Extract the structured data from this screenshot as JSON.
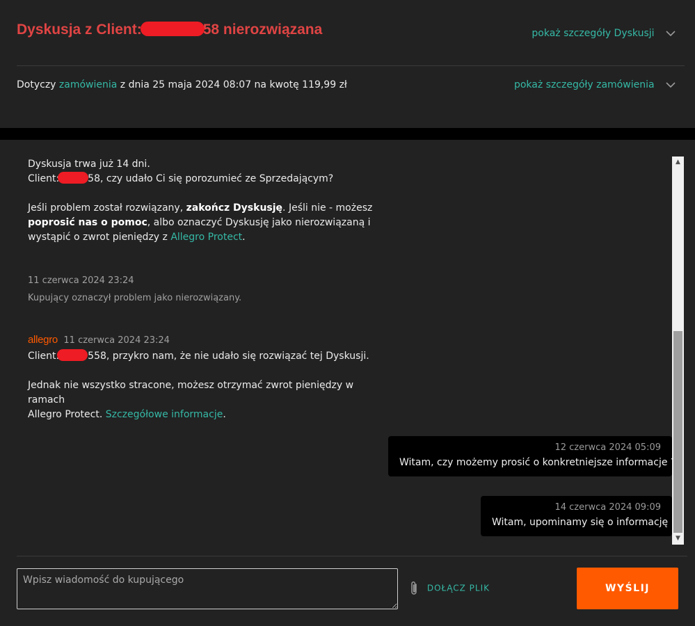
{
  "header": {
    "title_prefix": "Dyskusja z Client:",
    "title_suffix": "58 nierozwiązana",
    "show_discussion_details": "pokaż szczegóły Dyskusji",
    "order_text_1": "Dotyczy",
    "order_link": "zamówienia",
    "order_text_2": "z dnia 25 maja 2024 08:07 na kwotę 119,99 zł",
    "show_order_details": "pokaż szczegóły zamówienia"
  },
  "thread": {
    "status_line1": "Dyskusja trwa już 14 dni.",
    "status_client": "Client:",
    "status_q": "558, czy udało Ci się porozumieć ze Sprzedającym?",
    "info_1": "Jeśli problem został rozwiązany,",
    "info_bold_1": "zakończ Dyskusję",
    "info_2": ". Jeśli nie - możesz",
    "info_bold_2": "poprosić nas o pomoc",
    "info_3": ", albo oznaczyć Dyskusję jako nierozwiązaną i",
    "info_4": "wystąpić o zwrot pieniędzy z",
    "info_link": "Allegro Protect",
    "info_end": ".",
    "event_time": "11 czerwca 2024 23:24",
    "event_text": "Kupujący oznaczył problem jako nierozwiązany.",
    "allegro_logo": "allegro",
    "allegro_time": "11 czerwca 2024 23:24",
    "allegro_client": "Client:",
    "allegro_msg_1": "9558, przykro nam, że nie udało się rozwiązać tej Dyskusji.",
    "allegro_msg_2": "Jednak nie wszystko stracone, możesz otrzymać zwrot pieniędzy w ramach",
    "allegro_msg_3": "Allegro Protect.",
    "allegro_link": "Szczegółowe informacje",
    "allegro_end": ".",
    "messages": [
      {
        "time": "12 czerwca 2024 05:09",
        "text": "Witam, czy możemy prosić o konkretniejsze informacje ?"
      },
      {
        "time": "14 czerwca 2024 09:09",
        "text": "Witam, upominamy się o informację"
      }
    ]
  },
  "composer": {
    "placeholder": "Wpisz wiadomość do kupującego",
    "attach_label": "DOŁĄCZ PLIK",
    "send_label": "WYŚLIJ"
  },
  "colors": {
    "accent": "#35b9a6",
    "title_red": "#e04444",
    "send_orange": "#ff5a00"
  }
}
